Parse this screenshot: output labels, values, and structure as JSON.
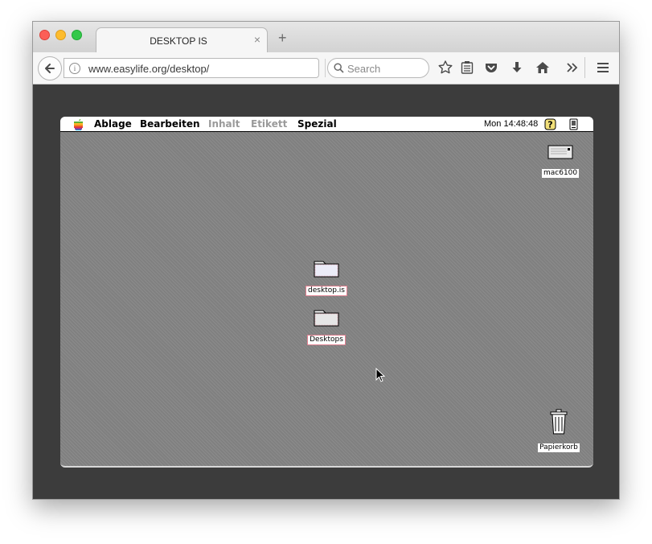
{
  "browser": {
    "tab_title": "DESKTOP IS",
    "tab_close": "×",
    "new_tab": "+",
    "url": "www.easylife.org/desktop/",
    "search_placeholder": "Search"
  },
  "mac": {
    "menu": {
      "items": [
        "Ablage",
        "Bearbeiten",
        "Inhalt",
        "Etikett",
        "Spezial"
      ],
      "disabled": [
        "Inhalt",
        "Etikett"
      ],
      "clock": "Mon 14:48:48"
    },
    "icons": {
      "drive": "mac6100",
      "folder1": "desktop.is",
      "folder2": "Desktops",
      "trash": "Papierkorb"
    }
  },
  "colors": {
    "desktop": "#808080",
    "frame": "#3c3c3c",
    "folder_highlight": "#e08090"
  }
}
